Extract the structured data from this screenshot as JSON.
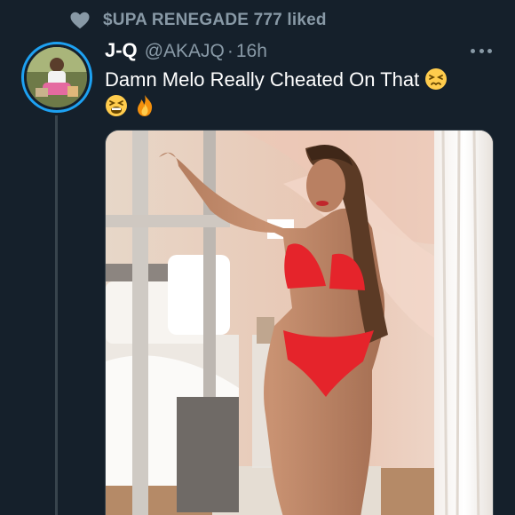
{
  "social_context": {
    "text": "$UPA RENEGADE 777 liked",
    "icon": "heart-icon"
  },
  "tweet": {
    "display_name": "J-Q",
    "handle": "@AKAJQ",
    "separator": "·",
    "timestamp": "16h",
    "text": "Damn Melo Really Cheated On That",
    "emojis": [
      "persevering-face-emoji",
      "tired-face-emoji",
      "fire-emoji"
    ]
  },
  "colors": {
    "background": "#15202b",
    "muted_text": "#8899a6",
    "accent": "#1da1f2",
    "divider": "#38444d"
  }
}
